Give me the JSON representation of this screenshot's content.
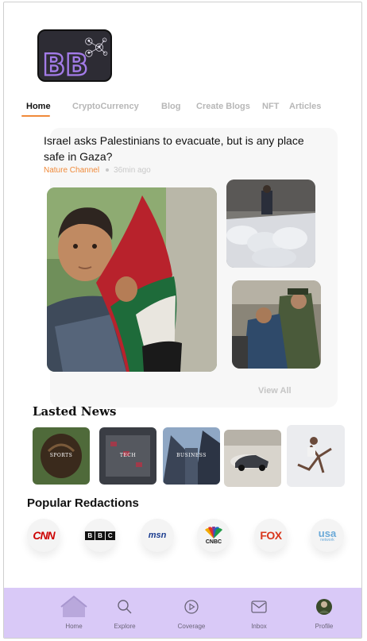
{
  "colors": {
    "accent": "#f08a3a",
    "nav_bg": "#d9c9f7",
    "logo_purple": "#a37be8"
  },
  "logo": {
    "text": "BB"
  },
  "tabs": [
    {
      "label": "Home",
      "active": true
    },
    {
      "label": "CryptoCurrency",
      "active": false
    },
    {
      "label": "Blog",
      "active": false
    },
    {
      "label": "Create Blogs",
      "active": false
    },
    {
      "label": "NFT",
      "active": false
    },
    {
      "label": "Articles",
      "active": false
    }
  ],
  "featured": {
    "headline": "Israel asks Palestinians to evacuate, but is any place safe in Gaza?",
    "source": "Nature Channel",
    "time": "36min ago",
    "view_all": "View All"
  },
  "lasted_news": {
    "title": "Lasted News",
    "items": [
      {
        "caption": "SPORTS"
      },
      {
        "caption": "TECH"
      },
      {
        "caption": "BUSINESS"
      },
      {
        "caption": ""
      },
      {
        "caption": ""
      }
    ]
  },
  "redactions": {
    "title": "Popular Redactions",
    "outlets": [
      {
        "name": "CNN"
      },
      {
        "name": "BBC"
      },
      {
        "name": "msn"
      },
      {
        "name": "CNBC"
      },
      {
        "name": "FOX"
      },
      {
        "name": "usa",
        "sub": "network"
      }
    ]
  },
  "nav": {
    "items": [
      {
        "label": "Home",
        "icon": "home-icon"
      },
      {
        "label": "Explore",
        "icon": "search-icon"
      },
      {
        "label": "Coverage",
        "icon": "play-circle-icon"
      },
      {
        "label": "Inbox",
        "icon": "mail-icon"
      },
      {
        "label": "Profile",
        "icon": "avatar"
      }
    ]
  }
}
